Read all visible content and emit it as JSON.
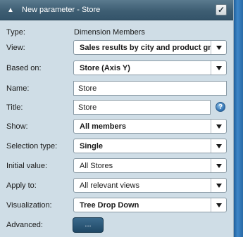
{
  "panel": {
    "title": "New parameter - Store",
    "checked": true
  },
  "fields": {
    "type": {
      "label": "Type:",
      "value": "Dimension Members"
    },
    "view": {
      "label": "View:",
      "value": "Sales results by city and product group"
    },
    "based_on": {
      "label": "Based on:",
      "value": "Store (Axis Y)"
    },
    "name": {
      "label": "Name:",
      "value": "Store"
    },
    "title": {
      "label": "Title:",
      "value": "Store"
    },
    "show": {
      "label": "Show:",
      "value": "All members"
    },
    "selection_type": {
      "label": "Selection type:",
      "value": "Single"
    },
    "initial_value": {
      "label": "Initial value:",
      "value": "All Stores"
    },
    "apply_to": {
      "label": "Apply to:",
      "value": "All relevant views"
    },
    "visualization": {
      "label": "Visualization:",
      "value": "Tree Drop Down"
    },
    "advanced": {
      "label": "Advanced:",
      "button_label": "..."
    }
  },
  "icons": {
    "collapse": "chevron-up-icon",
    "help": "help-icon",
    "dropdown": "triangle-down-icon"
  },
  "colors": {
    "panel_bg": "#cfdde6",
    "titlebar": "#3e5e73",
    "accent_strip": "#2a6aa6",
    "button": "#1f4866"
  }
}
